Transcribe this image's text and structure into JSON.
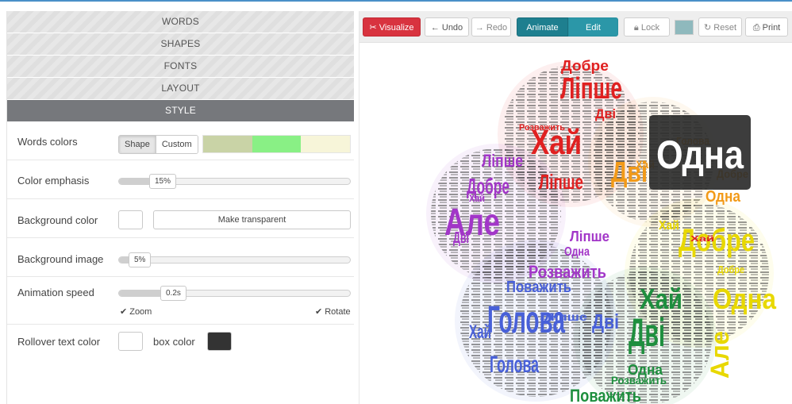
{
  "accordion": [
    {
      "label": "WORDS",
      "active": false
    },
    {
      "label": "SHAPES",
      "active": false
    },
    {
      "label": "FONTS",
      "active": false
    },
    {
      "label": "LAYOUT",
      "active": false
    },
    {
      "label": "STYLE",
      "active": true
    }
  ],
  "style": {
    "words_colors": {
      "label": "Words colors",
      "shape_label": "Shape",
      "custom_label": "Custom",
      "selected": "Shape",
      "palette": [
        "#c9d3a6",
        "#89f085",
        "#f7f5d9"
      ]
    },
    "color_emphasis": {
      "label": "Color emphasis",
      "value": "15%",
      "fraction": 0.15
    },
    "background_color": {
      "label": "Background color",
      "transparent_button": "Make transparent",
      "swatch": "#ffffff"
    },
    "background_image": {
      "label": "Background image",
      "value": "5%",
      "fraction": 0.05
    },
    "animation_speed": {
      "label": "Animation speed",
      "value": "0.2s",
      "fraction": 0.2,
      "zoom_label": "Zoom",
      "zoom_checked": true,
      "rotate_label": "Rotate",
      "rotate_checked": true
    },
    "rollover": {
      "label": "Rollover text color",
      "text_swatch": "#ffffff",
      "box_label": "box color",
      "box_swatch": "#333333"
    }
  },
  "toolbar": {
    "visualize": "Visualize",
    "undo": "Undo",
    "redo": "Redo",
    "animate": "Animate",
    "edit": "Edit",
    "lock": "Lock",
    "reset": "Reset",
    "print": "Print",
    "color_swatch": "#8fb9bd"
  },
  "cloud": {
    "tooltip_word": "Одна",
    "petal_colors": [
      "#e02020",
      "#f29a18",
      "#f5e400",
      "#1e8f3e",
      "#4860d8",
      "#a236c8"
    ],
    "words": [
      {
        "text": "Лiпше",
        "color": "#e02020"
      },
      {
        "text": "Добре",
        "color": "#e02020"
      },
      {
        "text": "Хай",
        "color": "#e02020"
      },
      {
        "text": "Двi",
        "color": "#e02020"
      },
      {
        "text": "Лiпше",
        "color": "#e02020"
      },
      {
        "text": "Розважить",
        "color": "#e02020"
      },
      {
        "text": "Двi",
        "color": "#f29a18"
      },
      {
        "text": "Хай",
        "color": "#f29a18"
      },
      {
        "text": "Голова",
        "color": "#f29a18"
      },
      {
        "text": "Одна",
        "color": "#f29a18"
      },
      {
        "text": "Добре",
        "color": "#f29a18"
      },
      {
        "text": "Добре",
        "color": "#e8d800"
      },
      {
        "text": "Одна",
        "color": "#e8d800"
      },
      {
        "text": "Але",
        "color": "#e8d800"
      },
      {
        "text": "Хай",
        "color": "#e8d800"
      },
      {
        "text": "Добре",
        "color": "#e8d800"
      },
      {
        "text": "Двi",
        "color": "#1e8f3e"
      },
      {
        "text": "Хай",
        "color": "#1e8f3e"
      },
      {
        "text": "Одна",
        "color": "#1e8f3e"
      },
      {
        "text": "Розважить",
        "color": "#1e8f3e"
      },
      {
        "text": "Поважить",
        "color": "#1e8f3e"
      },
      {
        "text": "Голова",
        "color": "#1e8f3e"
      },
      {
        "text": "Голова",
        "color": "#4860d8"
      },
      {
        "text": "Голова",
        "color": "#4860d8"
      },
      {
        "text": "Двi",
        "color": "#4860d8"
      },
      {
        "text": "Поважить",
        "color": "#4860d8"
      },
      {
        "text": "Хай",
        "color": "#4860d8"
      },
      {
        "text": "Лiпше",
        "color": "#4860d8"
      },
      {
        "text": "Розважить",
        "color": "#a236c8"
      },
      {
        "text": "Але",
        "color": "#a236c8"
      },
      {
        "text": "Добре",
        "color": "#a236c8"
      },
      {
        "text": "Лiпше",
        "color": "#a236c8"
      },
      {
        "text": "Двi",
        "color": "#a236c8"
      },
      {
        "text": "Хай",
        "color": "#a236c8"
      },
      {
        "text": "Лiпше",
        "color": "#a236c8"
      },
      {
        "text": "Одна",
        "color": "#a236c8"
      },
      {
        "text": "Хай",
        "color": "#e02020"
      }
    ]
  }
}
